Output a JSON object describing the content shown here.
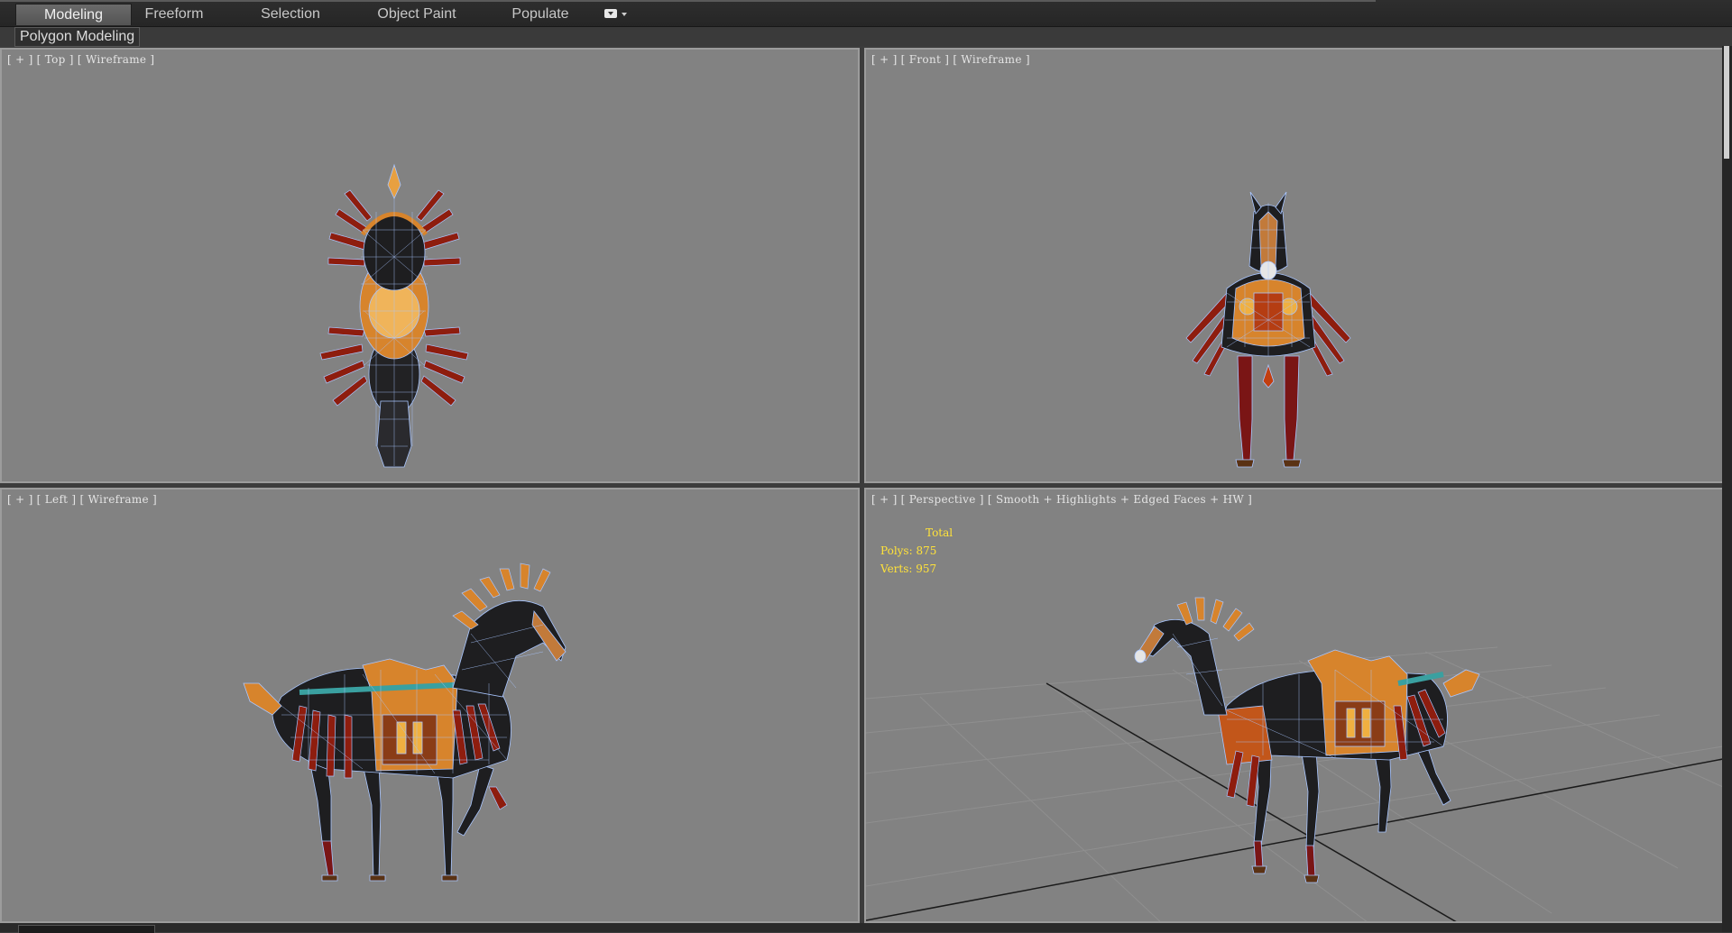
{
  "ribbon": {
    "tabs": [
      {
        "label": "Modeling",
        "active": true
      },
      {
        "label": "Freeform",
        "active": false
      },
      {
        "label": "Selection",
        "active": false
      },
      {
        "label": "Object Paint",
        "active": false
      },
      {
        "label": "Populate",
        "active": false
      }
    ],
    "panel_button": "Polygon Modeling"
  },
  "viewports": {
    "top": {
      "plus": "[ + ]",
      "name": "[ Top ]",
      "mode": "[ Wireframe ]"
    },
    "front": {
      "plus": "[ + ]",
      "name": "[ Front ]",
      "mode": "[ Wireframe ]"
    },
    "left": {
      "plus": "[ + ]",
      "name": "[ Left ]",
      "mode": "[ Wireframe ]"
    },
    "perspective": {
      "plus": "[ + ]",
      "name": "[ Perspective ]",
      "mode": "[ Smooth + Highlights + Edged Faces + HW ]",
      "stats": {
        "header": "Total",
        "polys_label": "Polys:",
        "polys_value": "875",
        "verts_label": "Verts:",
        "verts_value": "957"
      }
    }
  },
  "colors": {
    "viewport_bg": "#828282",
    "wire": "#a9c6ff",
    "body": "#1e1e20",
    "armor": "#d7842c",
    "spike": "#8e1d0e",
    "stats_text": "#ffe23a"
  }
}
